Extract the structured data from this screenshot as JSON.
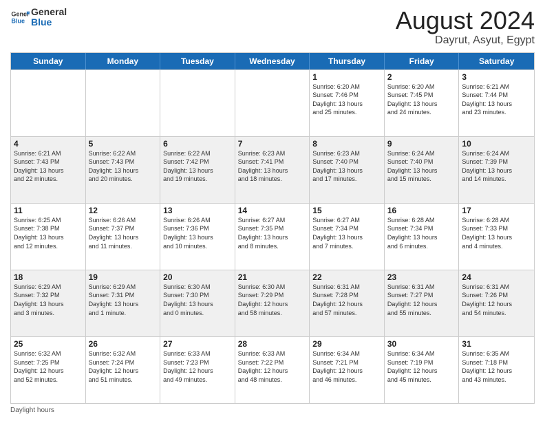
{
  "logo": {
    "line1": "General",
    "line2": "Blue"
  },
  "title": "August 2024",
  "subtitle": "Dayrut, Asyut, Egypt",
  "weekdays": [
    "Sunday",
    "Monday",
    "Tuesday",
    "Wednesday",
    "Thursday",
    "Friday",
    "Saturday"
  ],
  "footer": "Daylight hours",
  "rows": [
    [
      {
        "day": "",
        "info": ""
      },
      {
        "day": "",
        "info": ""
      },
      {
        "day": "",
        "info": ""
      },
      {
        "day": "",
        "info": ""
      },
      {
        "day": "1",
        "info": "Sunrise: 6:20 AM\nSunset: 7:46 PM\nDaylight: 13 hours\nand 25 minutes."
      },
      {
        "day": "2",
        "info": "Sunrise: 6:20 AM\nSunset: 7:45 PM\nDaylight: 13 hours\nand 24 minutes."
      },
      {
        "day": "3",
        "info": "Sunrise: 6:21 AM\nSunset: 7:44 PM\nDaylight: 13 hours\nand 23 minutes."
      }
    ],
    [
      {
        "day": "4",
        "info": "Sunrise: 6:21 AM\nSunset: 7:43 PM\nDaylight: 13 hours\nand 22 minutes."
      },
      {
        "day": "5",
        "info": "Sunrise: 6:22 AM\nSunset: 7:43 PM\nDaylight: 13 hours\nand 20 minutes."
      },
      {
        "day": "6",
        "info": "Sunrise: 6:22 AM\nSunset: 7:42 PM\nDaylight: 13 hours\nand 19 minutes."
      },
      {
        "day": "7",
        "info": "Sunrise: 6:23 AM\nSunset: 7:41 PM\nDaylight: 13 hours\nand 18 minutes."
      },
      {
        "day": "8",
        "info": "Sunrise: 6:23 AM\nSunset: 7:40 PM\nDaylight: 13 hours\nand 17 minutes."
      },
      {
        "day": "9",
        "info": "Sunrise: 6:24 AM\nSunset: 7:40 PM\nDaylight: 13 hours\nand 15 minutes."
      },
      {
        "day": "10",
        "info": "Sunrise: 6:24 AM\nSunset: 7:39 PM\nDaylight: 13 hours\nand 14 minutes."
      }
    ],
    [
      {
        "day": "11",
        "info": "Sunrise: 6:25 AM\nSunset: 7:38 PM\nDaylight: 13 hours\nand 12 minutes."
      },
      {
        "day": "12",
        "info": "Sunrise: 6:26 AM\nSunset: 7:37 PM\nDaylight: 13 hours\nand 11 minutes."
      },
      {
        "day": "13",
        "info": "Sunrise: 6:26 AM\nSunset: 7:36 PM\nDaylight: 13 hours\nand 10 minutes."
      },
      {
        "day": "14",
        "info": "Sunrise: 6:27 AM\nSunset: 7:35 PM\nDaylight: 13 hours\nand 8 minutes."
      },
      {
        "day": "15",
        "info": "Sunrise: 6:27 AM\nSunset: 7:34 PM\nDaylight: 13 hours\nand 7 minutes."
      },
      {
        "day": "16",
        "info": "Sunrise: 6:28 AM\nSunset: 7:34 PM\nDaylight: 13 hours\nand 6 minutes."
      },
      {
        "day": "17",
        "info": "Sunrise: 6:28 AM\nSunset: 7:33 PM\nDaylight: 13 hours\nand 4 minutes."
      }
    ],
    [
      {
        "day": "18",
        "info": "Sunrise: 6:29 AM\nSunset: 7:32 PM\nDaylight: 13 hours\nand 3 minutes."
      },
      {
        "day": "19",
        "info": "Sunrise: 6:29 AM\nSunset: 7:31 PM\nDaylight: 13 hours\nand 1 minute."
      },
      {
        "day": "20",
        "info": "Sunrise: 6:30 AM\nSunset: 7:30 PM\nDaylight: 13 hours\nand 0 minutes."
      },
      {
        "day": "21",
        "info": "Sunrise: 6:30 AM\nSunset: 7:29 PM\nDaylight: 12 hours\nand 58 minutes."
      },
      {
        "day": "22",
        "info": "Sunrise: 6:31 AM\nSunset: 7:28 PM\nDaylight: 12 hours\nand 57 minutes."
      },
      {
        "day": "23",
        "info": "Sunrise: 6:31 AM\nSunset: 7:27 PM\nDaylight: 12 hours\nand 55 minutes."
      },
      {
        "day": "24",
        "info": "Sunrise: 6:31 AM\nSunset: 7:26 PM\nDaylight: 12 hours\nand 54 minutes."
      }
    ],
    [
      {
        "day": "25",
        "info": "Sunrise: 6:32 AM\nSunset: 7:25 PM\nDaylight: 12 hours\nand 52 minutes."
      },
      {
        "day": "26",
        "info": "Sunrise: 6:32 AM\nSunset: 7:24 PM\nDaylight: 12 hours\nand 51 minutes."
      },
      {
        "day": "27",
        "info": "Sunrise: 6:33 AM\nSunset: 7:23 PM\nDaylight: 12 hours\nand 49 minutes."
      },
      {
        "day": "28",
        "info": "Sunrise: 6:33 AM\nSunset: 7:22 PM\nDaylight: 12 hours\nand 48 minutes."
      },
      {
        "day": "29",
        "info": "Sunrise: 6:34 AM\nSunset: 7:21 PM\nDaylight: 12 hours\nand 46 minutes."
      },
      {
        "day": "30",
        "info": "Sunrise: 6:34 AM\nSunset: 7:19 PM\nDaylight: 12 hours\nand 45 minutes."
      },
      {
        "day": "31",
        "info": "Sunrise: 6:35 AM\nSunset: 7:18 PM\nDaylight: 12 hours\nand 43 minutes."
      }
    ]
  ]
}
